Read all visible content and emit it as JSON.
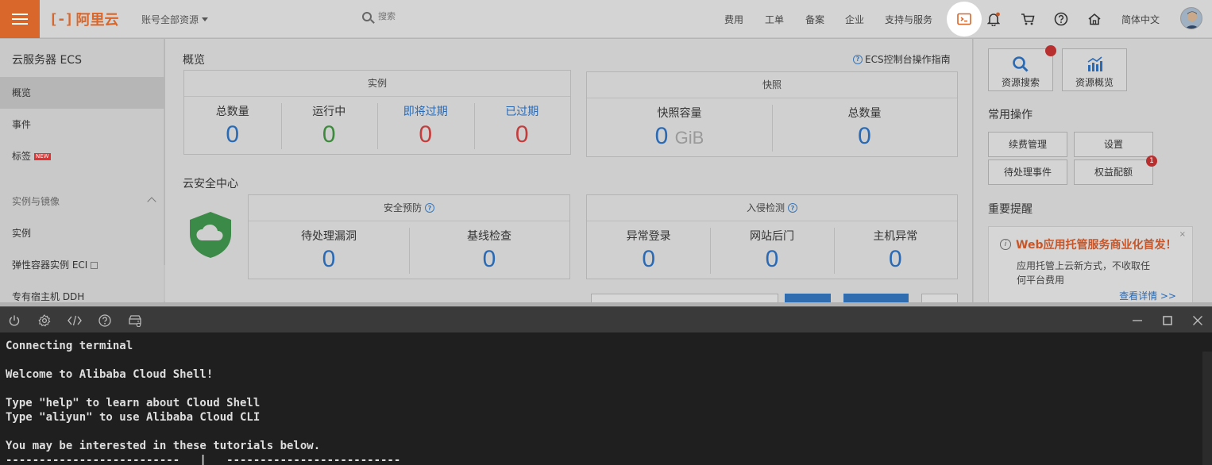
{
  "topbar": {
    "logo_text": "阿里云",
    "logo_mark": "[-]",
    "account_selector": "账号全部资源",
    "search_placeholder": "搜索",
    "nav": [
      "费用",
      "工单",
      "备案",
      "企业",
      "支持与服务"
    ],
    "language": "简体中文"
  },
  "sidebar": {
    "title": "云服务器 ECS",
    "items": [
      {
        "label": "概览",
        "active": true
      },
      {
        "label": "事件"
      },
      {
        "label": "标签",
        "badge": "NEW"
      }
    ],
    "group_label": "实例与镜像",
    "group_items": [
      "实例",
      "弹性容器实例 ECI",
      "专有宿主机 DDH"
    ]
  },
  "main": {
    "overview_title": "概览",
    "guide_link": "ECS控制台操作指南",
    "instances": {
      "header": "实例",
      "cells": [
        {
          "label": "总数量",
          "value": "0",
          "color": "#2a6ab4"
        },
        {
          "label": "运行中",
          "value": "0",
          "color": "#3d8a3d"
        },
        {
          "label": "即将过期",
          "value": "0",
          "color": "#c43d3d"
        },
        {
          "label": "已过期",
          "value": "0",
          "color": "#c43d3d"
        }
      ]
    },
    "snapshots": {
      "header": "快照",
      "capacity_label": "快照容量",
      "capacity_value": "0",
      "capacity_unit": "GiB",
      "total_label": "总数量",
      "total_value": "0"
    },
    "security_title": "云安全中心",
    "prevention": {
      "header": "安全预防",
      "cells": [
        {
          "label": "待处理漏洞",
          "value": "0"
        },
        {
          "label": "基线检查",
          "value": "0"
        }
      ]
    },
    "intrusion": {
      "header": "入侵检测",
      "cells": [
        {
          "label": "异常登录",
          "value": "0"
        },
        {
          "label": "网站后门",
          "value": "0"
        },
        {
          "label": "主机异常",
          "value": "0"
        }
      ]
    }
  },
  "right": {
    "resource_search": "资源搜索",
    "resource_overview": "资源概览",
    "common_ops_title": "常用操作",
    "ops": [
      "续费管理",
      "设置",
      "待处理事件",
      "权益配额"
    ],
    "quota_badge": "1",
    "reminder_title": "重要提醒",
    "notice": {
      "title": "Web应用托管服务商业化首发！",
      "body": "应用托管上云新方式，不收取任何平台费用",
      "link": "查看详情 >>",
      "close": "×"
    }
  },
  "terminal": {
    "lines": [
      "Connecting terminal",
      "",
      "Welcome to Alibaba Cloud Shell!",
      "",
      "Type \"help\" to learn about Cloud Shell",
      "Type \"aliyun\" to use Alibaba Cloud CLI",
      "",
      "You may be interested in these tutorials below.",
      "--------------------------   |   --------------------------"
    ]
  }
}
